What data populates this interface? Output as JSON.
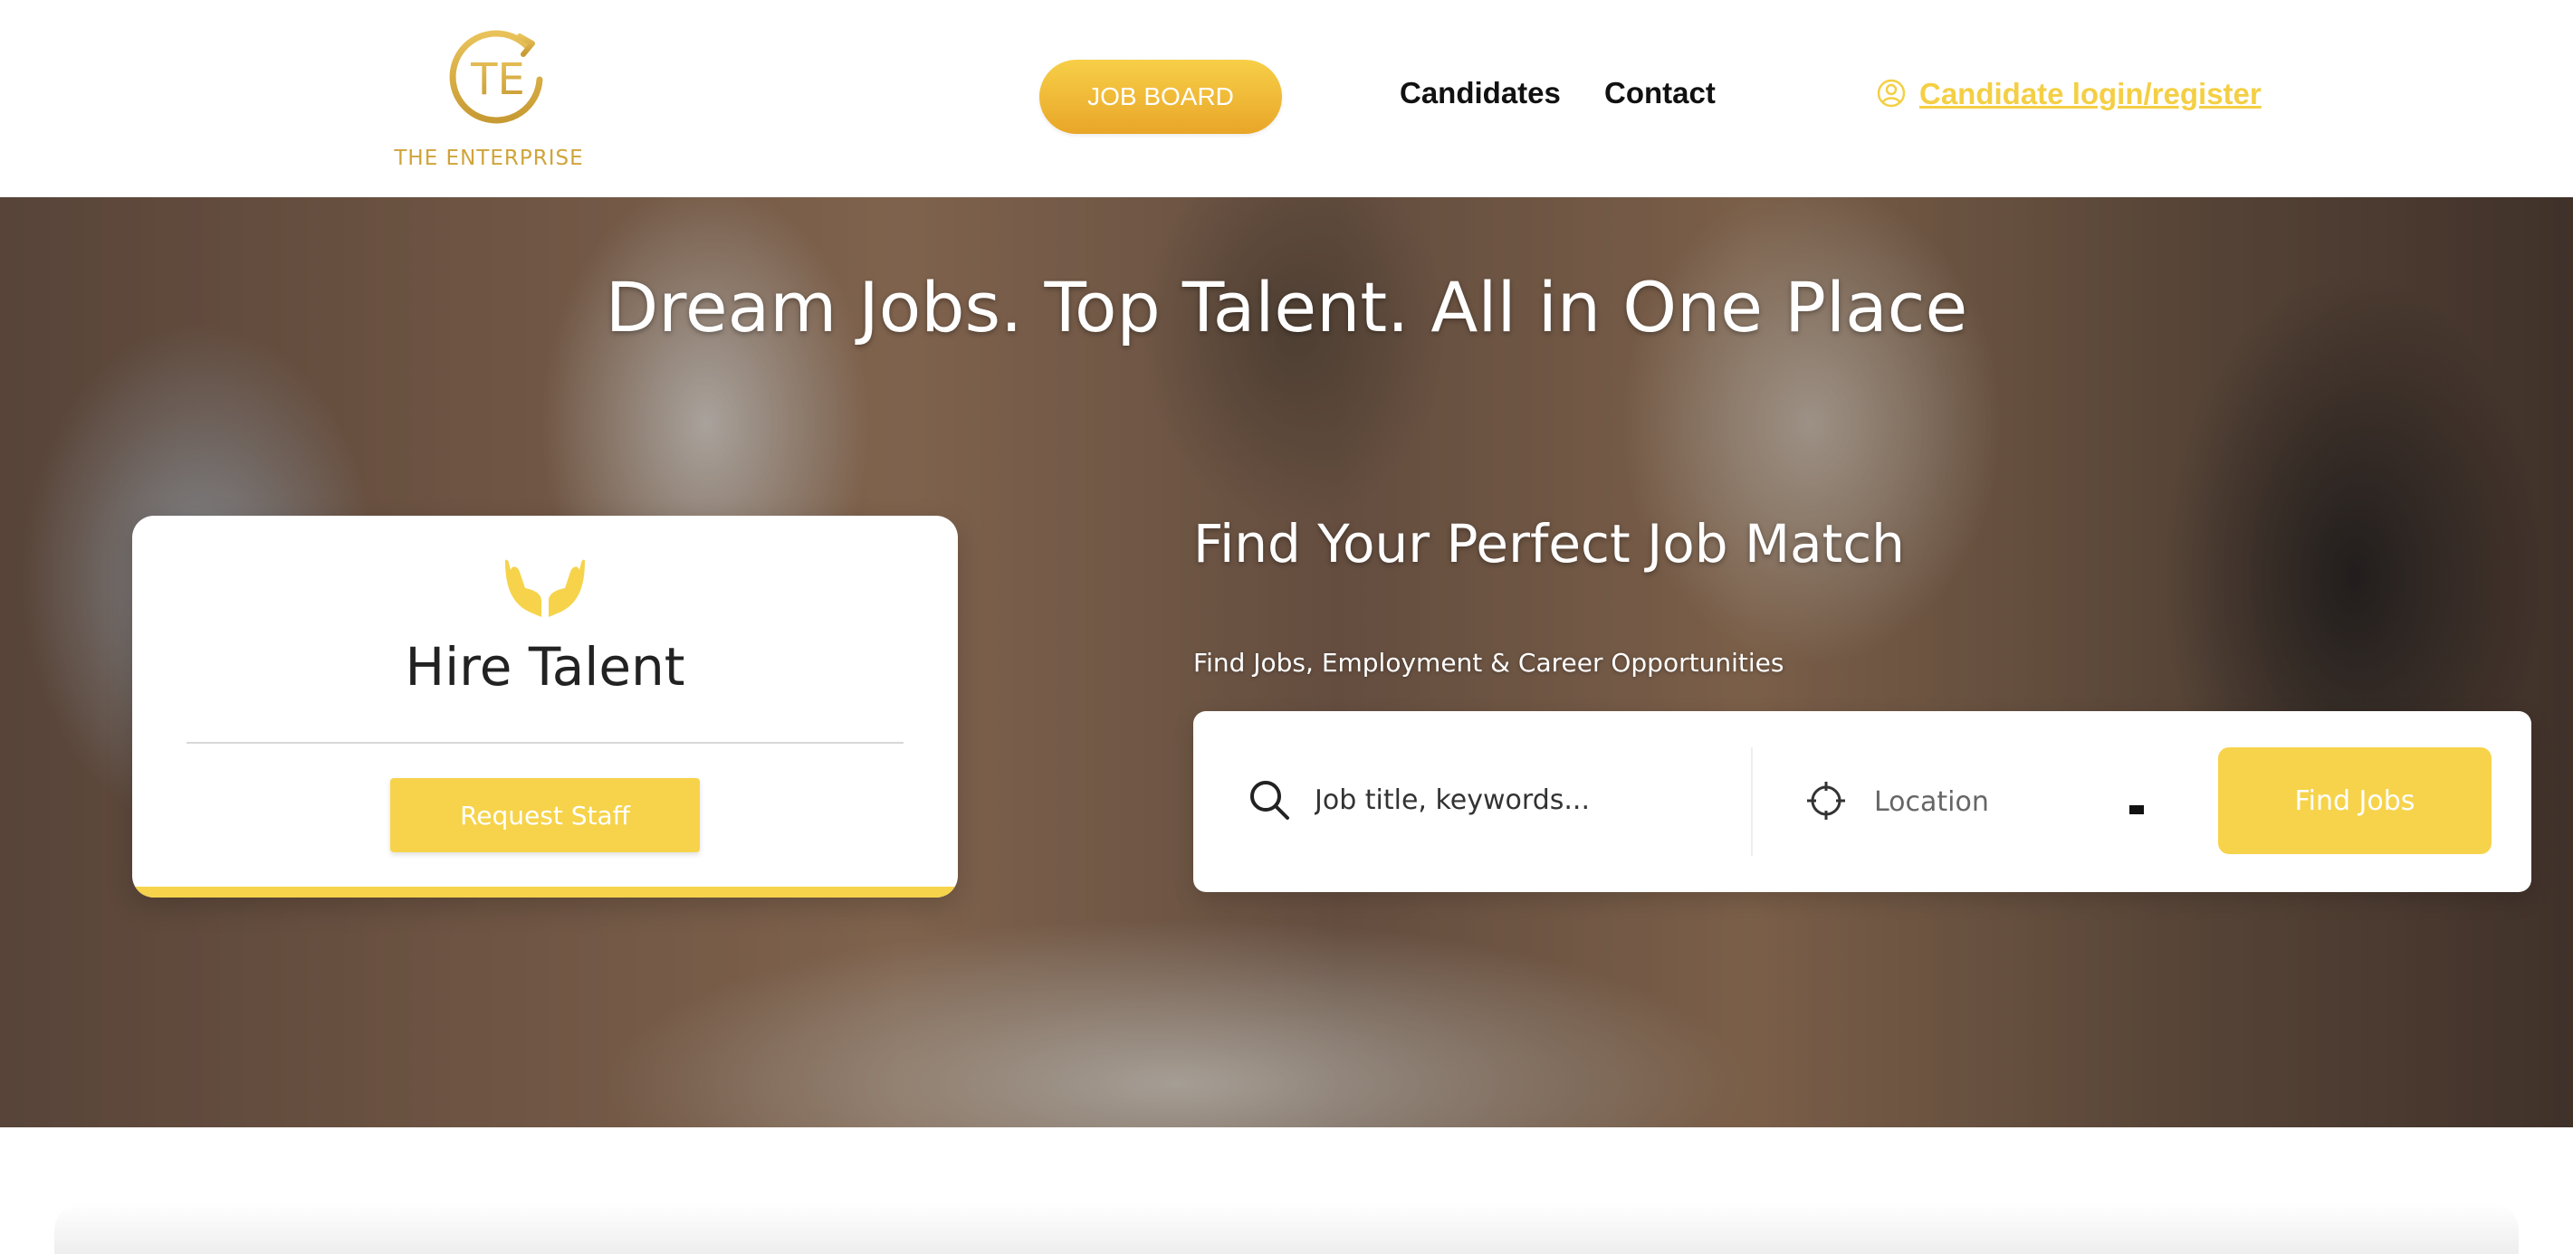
{
  "header": {
    "logo": {
      "text": "THE ENTERPRISE",
      "monogram": "TE",
      "color": "#cfa43a"
    },
    "nav": {
      "job_board": "JOB BOARD",
      "candidates": "Candidates",
      "contact": "Contact"
    },
    "login": {
      "label": "Candidate login/register",
      "icon": "user-circle-icon",
      "color": "#f4cf45"
    }
  },
  "hero": {
    "title": "Dream Jobs. Top Talent. All in One Place",
    "hire_card": {
      "icon": "hands-icon",
      "title": "Hire Talent",
      "button": "Request Staff"
    },
    "search": {
      "title": "Find Your Perfect Job Match",
      "subtitle": "Find Jobs, Employment & Career Opportunities",
      "keyword_placeholder": "Job title, keywords...",
      "location_placeholder": "Location",
      "button": "Find Jobs"
    }
  },
  "colors": {
    "accent": "#f6d34b",
    "nav_button": "#eeb936"
  }
}
